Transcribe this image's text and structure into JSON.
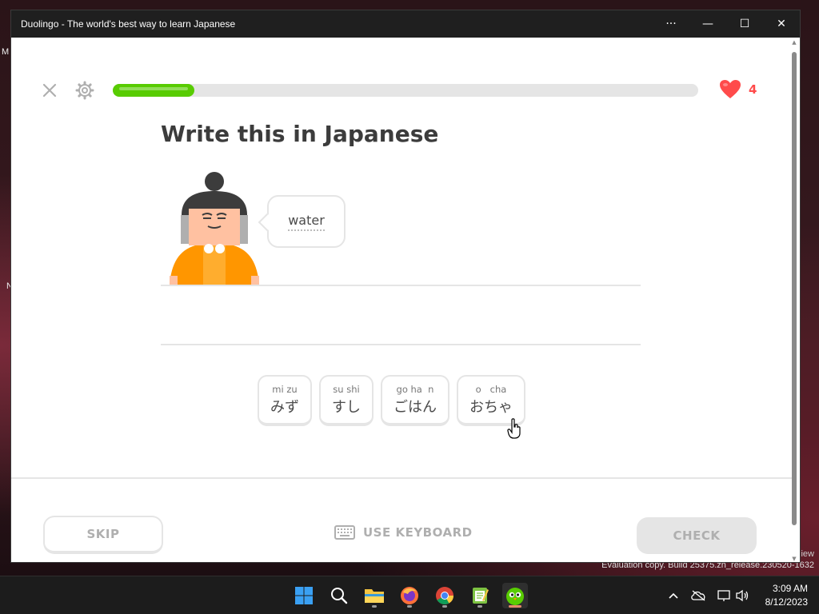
{
  "window": {
    "title": "Duolingo - The world's best way to learn Japanese",
    "controls": [
      "···",
      "—",
      "☐",
      "✕"
    ]
  },
  "lesson": {
    "progress_percent": 14,
    "hearts": "4",
    "prompt_title": "Write this in Japanese",
    "speech_word": "water",
    "word_bank": [
      {
        "romaji": "mi zu",
        "kana": "みず"
      },
      {
        "romaji": "su shi",
        "kana": "すし"
      },
      {
        "romaji": "go ha  n",
        "kana": "ごはん"
      },
      {
        "romaji": "o   cha",
        "kana": "おちゃ"
      }
    ],
    "skip_label": "SKIP",
    "keyboard_label": "USE KEYBOARD",
    "check_label": "CHECK"
  },
  "colors": {
    "progress": "#58cc02",
    "heart": "#ff4b4b",
    "character_shirt": "#ff9600"
  },
  "desktop": {
    "watermark_line1": "iew",
    "watermark_line2": "Evaluation copy. Build 25375.zn_release.230520-1632",
    "fragment_m": "M",
    "fragment_n": "N"
  },
  "taskbar": {
    "apps": [
      "start-icon",
      "search-icon",
      "file-explorer-icon",
      "firefox-icon",
      "chrome-icon",
      "notepad-icon",
      "duolingo-icon"
    ],
    "time": "3:09 AM",
    "date": "8/12/2023"
  }
}
